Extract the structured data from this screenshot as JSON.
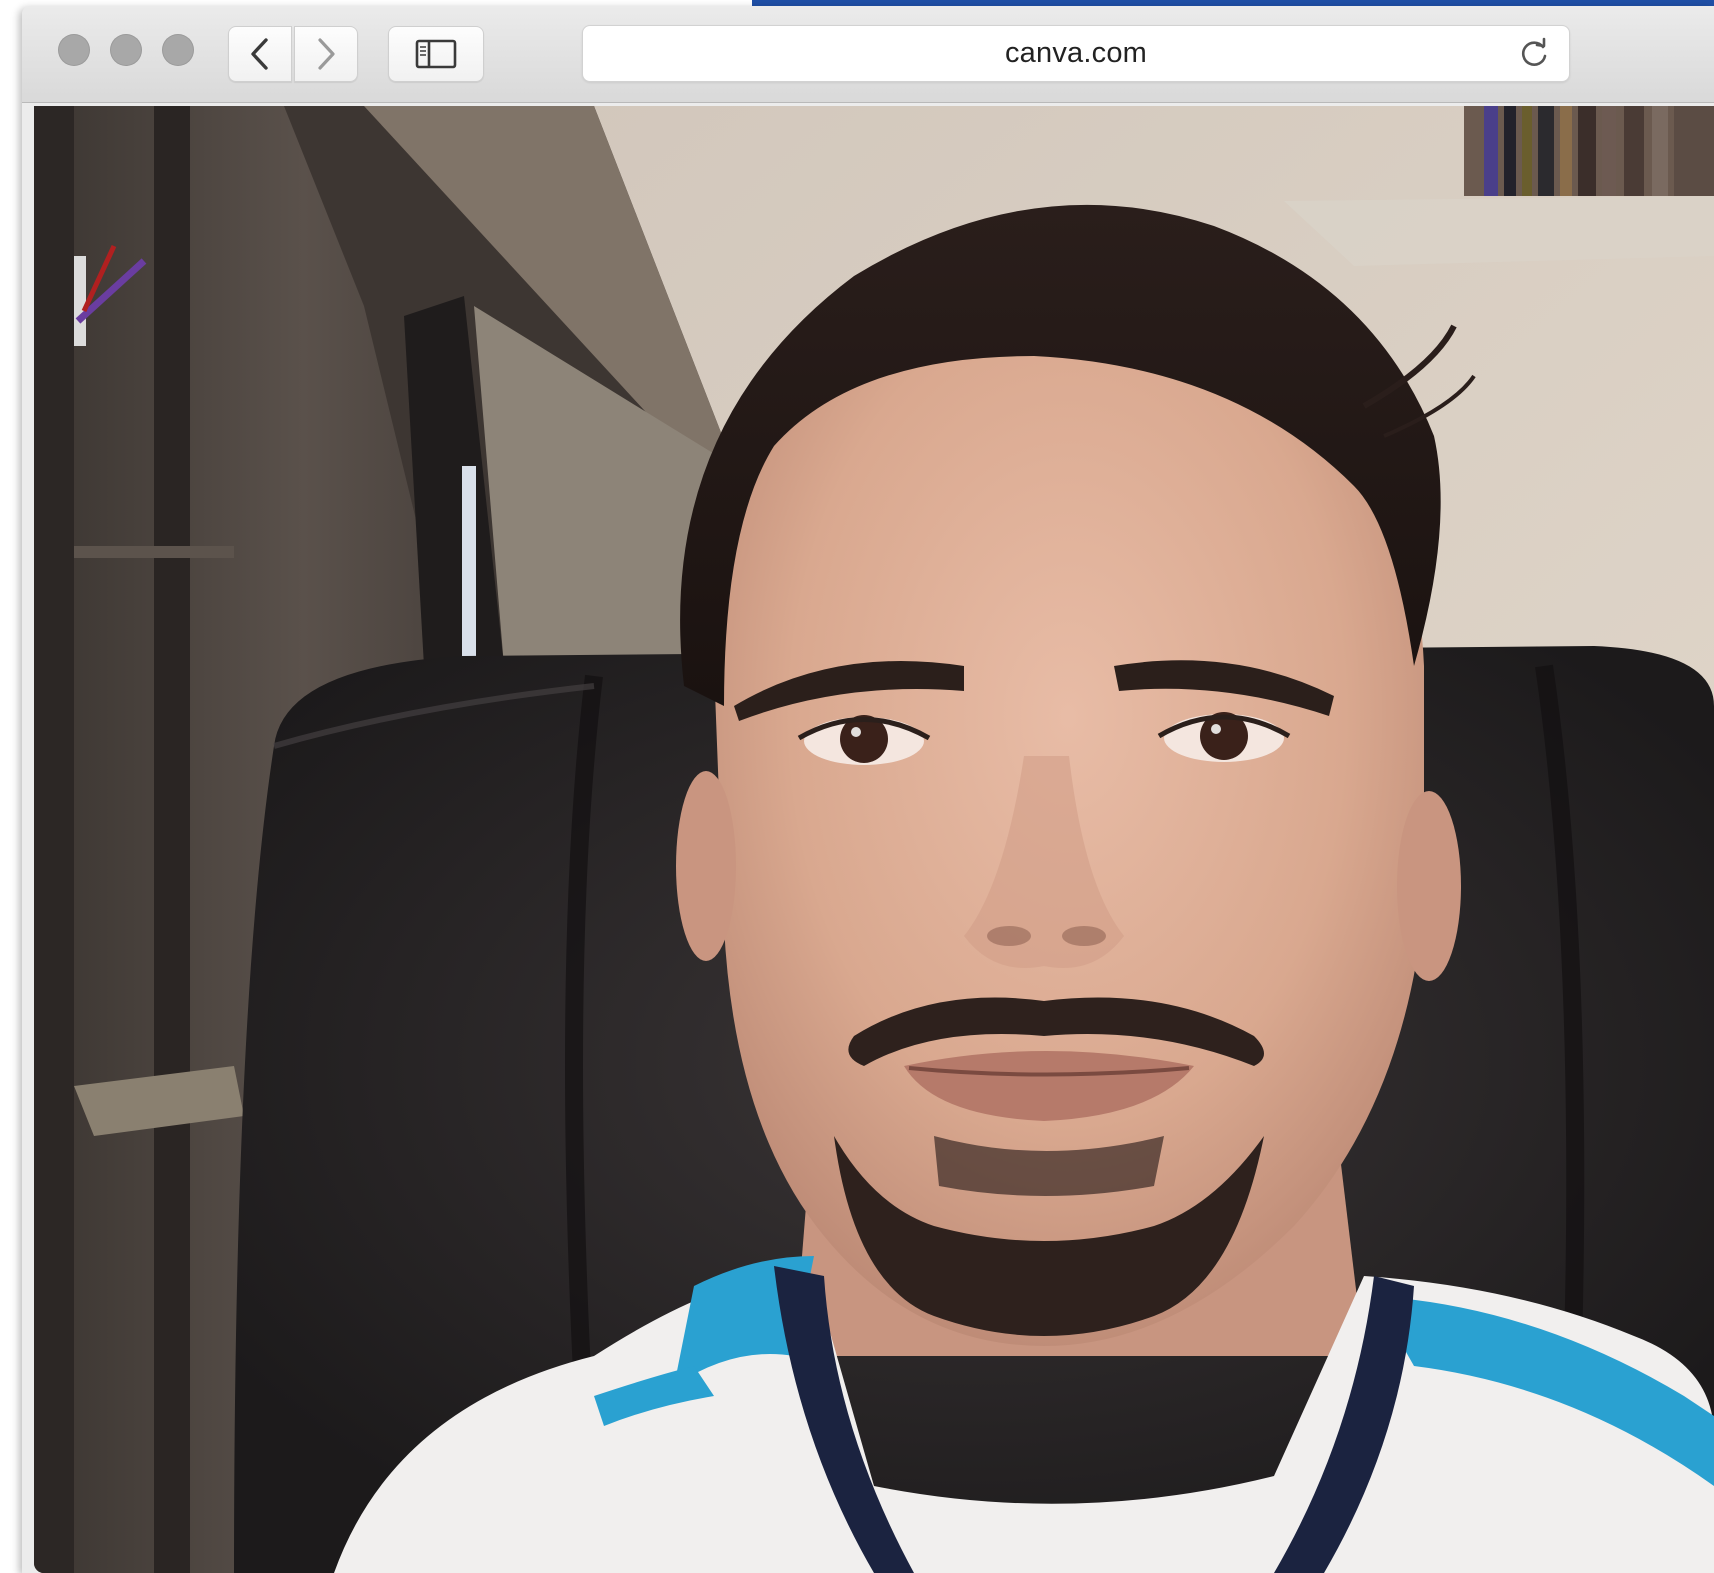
{
  "browser": {
    "address_bar": {
      "url": "canva.com"
    },
    "icons": {
      "back": "chevron-left-icon",
      "forward": "chevron-right-icon",
      "sidebar": "sidebar-icon",
      "reload": "reload-icon"
    }
  },
  "content": {
    "type": "photo",
    "subject": "selfie"
  },
  "colors": {
    "accent_bar": "#1f4fa6",
    "toolbar": "#e3e3e3",
    "traffic_lights": "#a8a8a8"
  }
}
